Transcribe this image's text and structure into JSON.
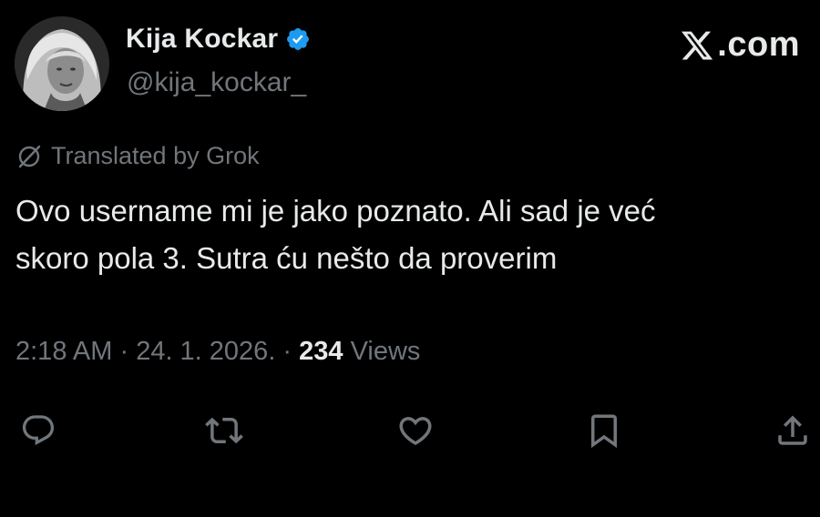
{
  "author": {
    "display_name": "Kija Kockar",
    "handle": "@kija_kockar_",
    "verified": true,
    "avatar_icon": "profile-photo"
  },
  "brand": {
    "logo_text": ".com",
    "logo_icon": "x-logo-icon"
  },
  "translation": {
    "label": "Translated by Grok",
    "icon": "translate-slash-icon"
  },
  "tweet": {
    "text_line1": "Ovo username mi je jako poznato. Ali sad je već",
    "text_line2": "skoro pola 3. Sutra ću nešto da proverim",
    "time": "2:18 AM",
    "sep1": " · ",
    "date": "24. 1. 2026.",
    "sep2": " · ",
    "views_count": "234",
    "views_label": " Views"
  },
  "actions": {
    "reply_icon": "reply-icon",
    "retweet_icon": "retweet-icon",
    "like_icon": "heart-icon",
    "bookmark_icon": "bookmark-icon",
    "share_icon": "share-icon"
  },
  "colors": {
    "background": "#000000",
    "text_primary": "#e7e9ea",
    "text_secondary": "#71767b",
    "verified_blue": "#1d9bf0"
  }
}
